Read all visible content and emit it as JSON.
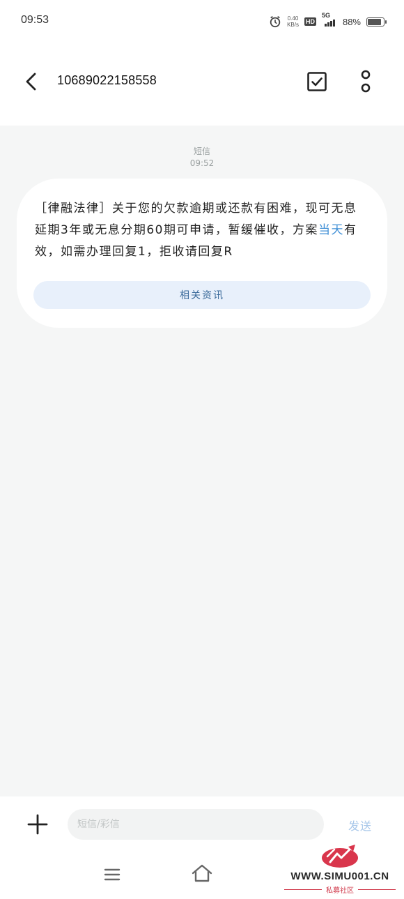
{
  "status_bar": {
    "time": "09:53",
    "net_speed_value": "0.40",
    "net_speed_unit": "KB/s",
    "hd_label": "HD",
    "network_label": "5G",
    "battery_percent": "88%",
    "battery_level": 0.88
  },
  "header": {
    "contact": "10689022158558",
    "icons": [
      "back-arrow-icon",
      "select-checkbox-icon",
      "more-vertical-icon"
    ]
  },
  "conversation": {
    "message_type": "短信",
    "message_time": "09:52",
    "message": {
      "text_before_link": "［律融法律］关于您的欠款逾期或还款有困难，现可无息延期3年或无息分期60期可申请，暂缓催收，方案",
      "link_text": "当天",
      "text_after_link": "有效，如需办理回复1，拒收请回复R"
    },
    "related_button_label": "相关资讯"
  },
  "composer": {
    "input_placeholder": "短信/彩信",
    "input_value": "",
    "send_label": "发送"
  },
  "nav_bar": {
    "icons": [
      "menu-icon",
      "home-icon"
    ]
  },
  "watermark": {
    "url": "WWW.SIMU001.CN",
    "subtitle": "私募社区"
  },
  "colors": {
    "conversation_bg": "#f5f6f6",
    "bubble_bg": "#ffffff",
    "link": "#3f8fd6",
    "related_button_bg": "#e8f0fb",
    "send_disabled": "#a9c8ea"
  }
}
